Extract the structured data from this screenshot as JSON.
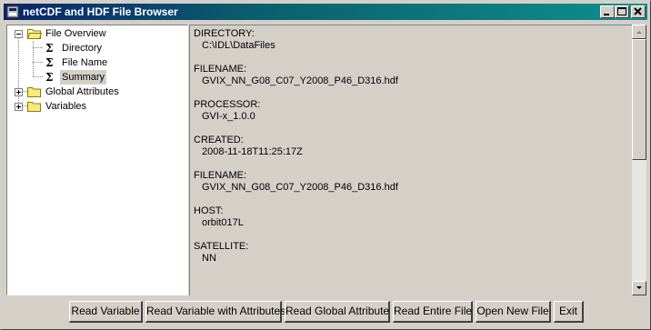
{
  "window": {
    "title": "netCDF and HDF File Browser"
  },
  "title_buttons": [
    "minimize-icon",
    "maximize-icon",
    "close-icon"
  ],
  "tree": {
    "items": [
      {
        "label": "File Overview",
        "icon": "folder-open-icon",
        "expander": "minus"
      },
      {
        "label": "Directory",
        "icon": "sigma-icon"
      },
      {
        "label": "File Name",
        "icon": "sigma-icon"
      },
      {
        "label": "Summary",
        "icon": "sigma-icon",
        "selected": true
      },
      {
        "label": "Global Attributes",
        "icon": "folder-icon",
        "expander": "plus"
      },
      {
        "label": "Variables",
        "icon": "folder-icon",
        "expander": "plus"
      }
    ]
  },
  "summary": [
    {
      "key": "DIRECTORY:",
      "value": "C:\\IDL\\DataFiles"
    },
    {
      "key": "FILENAME:",
      "value": "GVIX_NN_G08_C07_Y2008_P46_D316.hdf"
    },
    {
      "key": "PROCESSOR:",
      "value": "GVI-x_1.0.0"
    },
    {
      "key": "CREATED:",
      "value": "2008-11-18T11:25:17Z"
    },
    {
      "key": "FILENAME:",
      "value": "GVIX_NN_G08_C07_Y2008_P46_D316.hdf"
    },
    {
      "key": "HOST:",
      "value": "orbit017L"
    },
    {
      "key": "SATELLITE:",
      "value": "NN"
    }
  ],
  "buttons": [
    {
      "label": "Read Variable"
    },
    {
      "label": "Read Variable with Attributes"
    },
    {
      "label": "Read Global Attribute"
    },
    {
      "label": "Read Entire File"
    },
    {
      "label": "Open New File"
    },
    {
      "label": "Exit"
    }
  ],
  "colors": {
    "titlebar_start": "#0a246a",
    "titlebar_end": "#0e8f8f",
    "face": "#d4d0c8"
  }
}
